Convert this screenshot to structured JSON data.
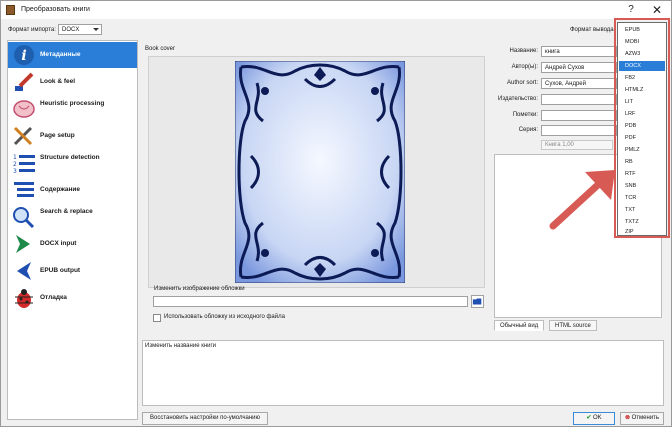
{
  "window": {
    "title": "Преобразовать книги",
    "help": "?",
    "close": "✕"
  },
  "input_format": {
    "label": "Формат импорта:",
    "value": "DOCX"
  },
  "output_format": {
    "label": "Формат вывода:"
  },
  "sidebar": {
    "items": [
      {
        "label": "Метаданные",
        "icon": "info-icon"
      },
      {
        "label": "Look & feel",
        "icon": "paintbrush-icon"
      },
      {
        "label": "Heuristic processing",
        "icon": "brain-icon"
      },
      {
        "label": "Page setup",
        "icon": "tools-icon"
      },
      {
        "label": "Structure detection",
        "icon": "list-numbered-icon"
      },
      {
        "label": "Содержание",
        "icon": "toc-icon"
      },
      {
        "label": "Search & replace",
        "icon": "magnifier-icon"
      },
      {
        "label": "DOCX input",
        "icon": "chevron-right-icon"
      },
      {
        "label": "EPUB output",
        "icon": "chevron-left-icon"
      },
      {
        "label": "Отладка",
        "icon": "bug-icon"
      }
    ]
  },
  "cover": {
    "group_label": "Book cover",
    "change_label": "Изменить изображение обложки",
    "use_source_label": "Использовать обложку из исходного файла"
  },
  "metadata": {
    "title_label": "Название:",
    "title_value": "книга",
    "authors_label": "Автор(ы):",
    "authors_value": "Андрей Сухов",
    "author_sort_label": "Author sort:",
    "author_sort_value": "Сухов, Андрей",
    "publisher_label": "Издательство:",
    "publisher_value": "",
    "tags_label": "Пометки:",
    "tags_value": "",
    "series_label": "Серия:",
    "series_value": "",
    "series_index": "Книга 1,00"
  },
  "comments_tabs": [
    "Обычный вид",
    "HTML source"
  ],
  "description_text": "Изменить название книги",
  "buttons": {
    "restore": "Восстановить настройки по-умолчанию",
    "ok": "OK",
    "cancel": "Отменить"
  },
  "output_formats": [
    "EPUB",
    "MOBI",
    "AZW3",
    "DOCX",
    "FB2",
    "HTMLZ",
    "LIT",
    "LRF",
    "PDB",
    "PDF",
    "PMLZ",
    "RB",
    "RTF",
    "SNB",
    "TCR",
    "TXT",
    "TXTZ",
    "ZIP"
  ],
  "output_selected": "DOCX",
  "colors": {
    "accent": "#2a7ed8",
    "highlight": "#d85a55"
  }
}
